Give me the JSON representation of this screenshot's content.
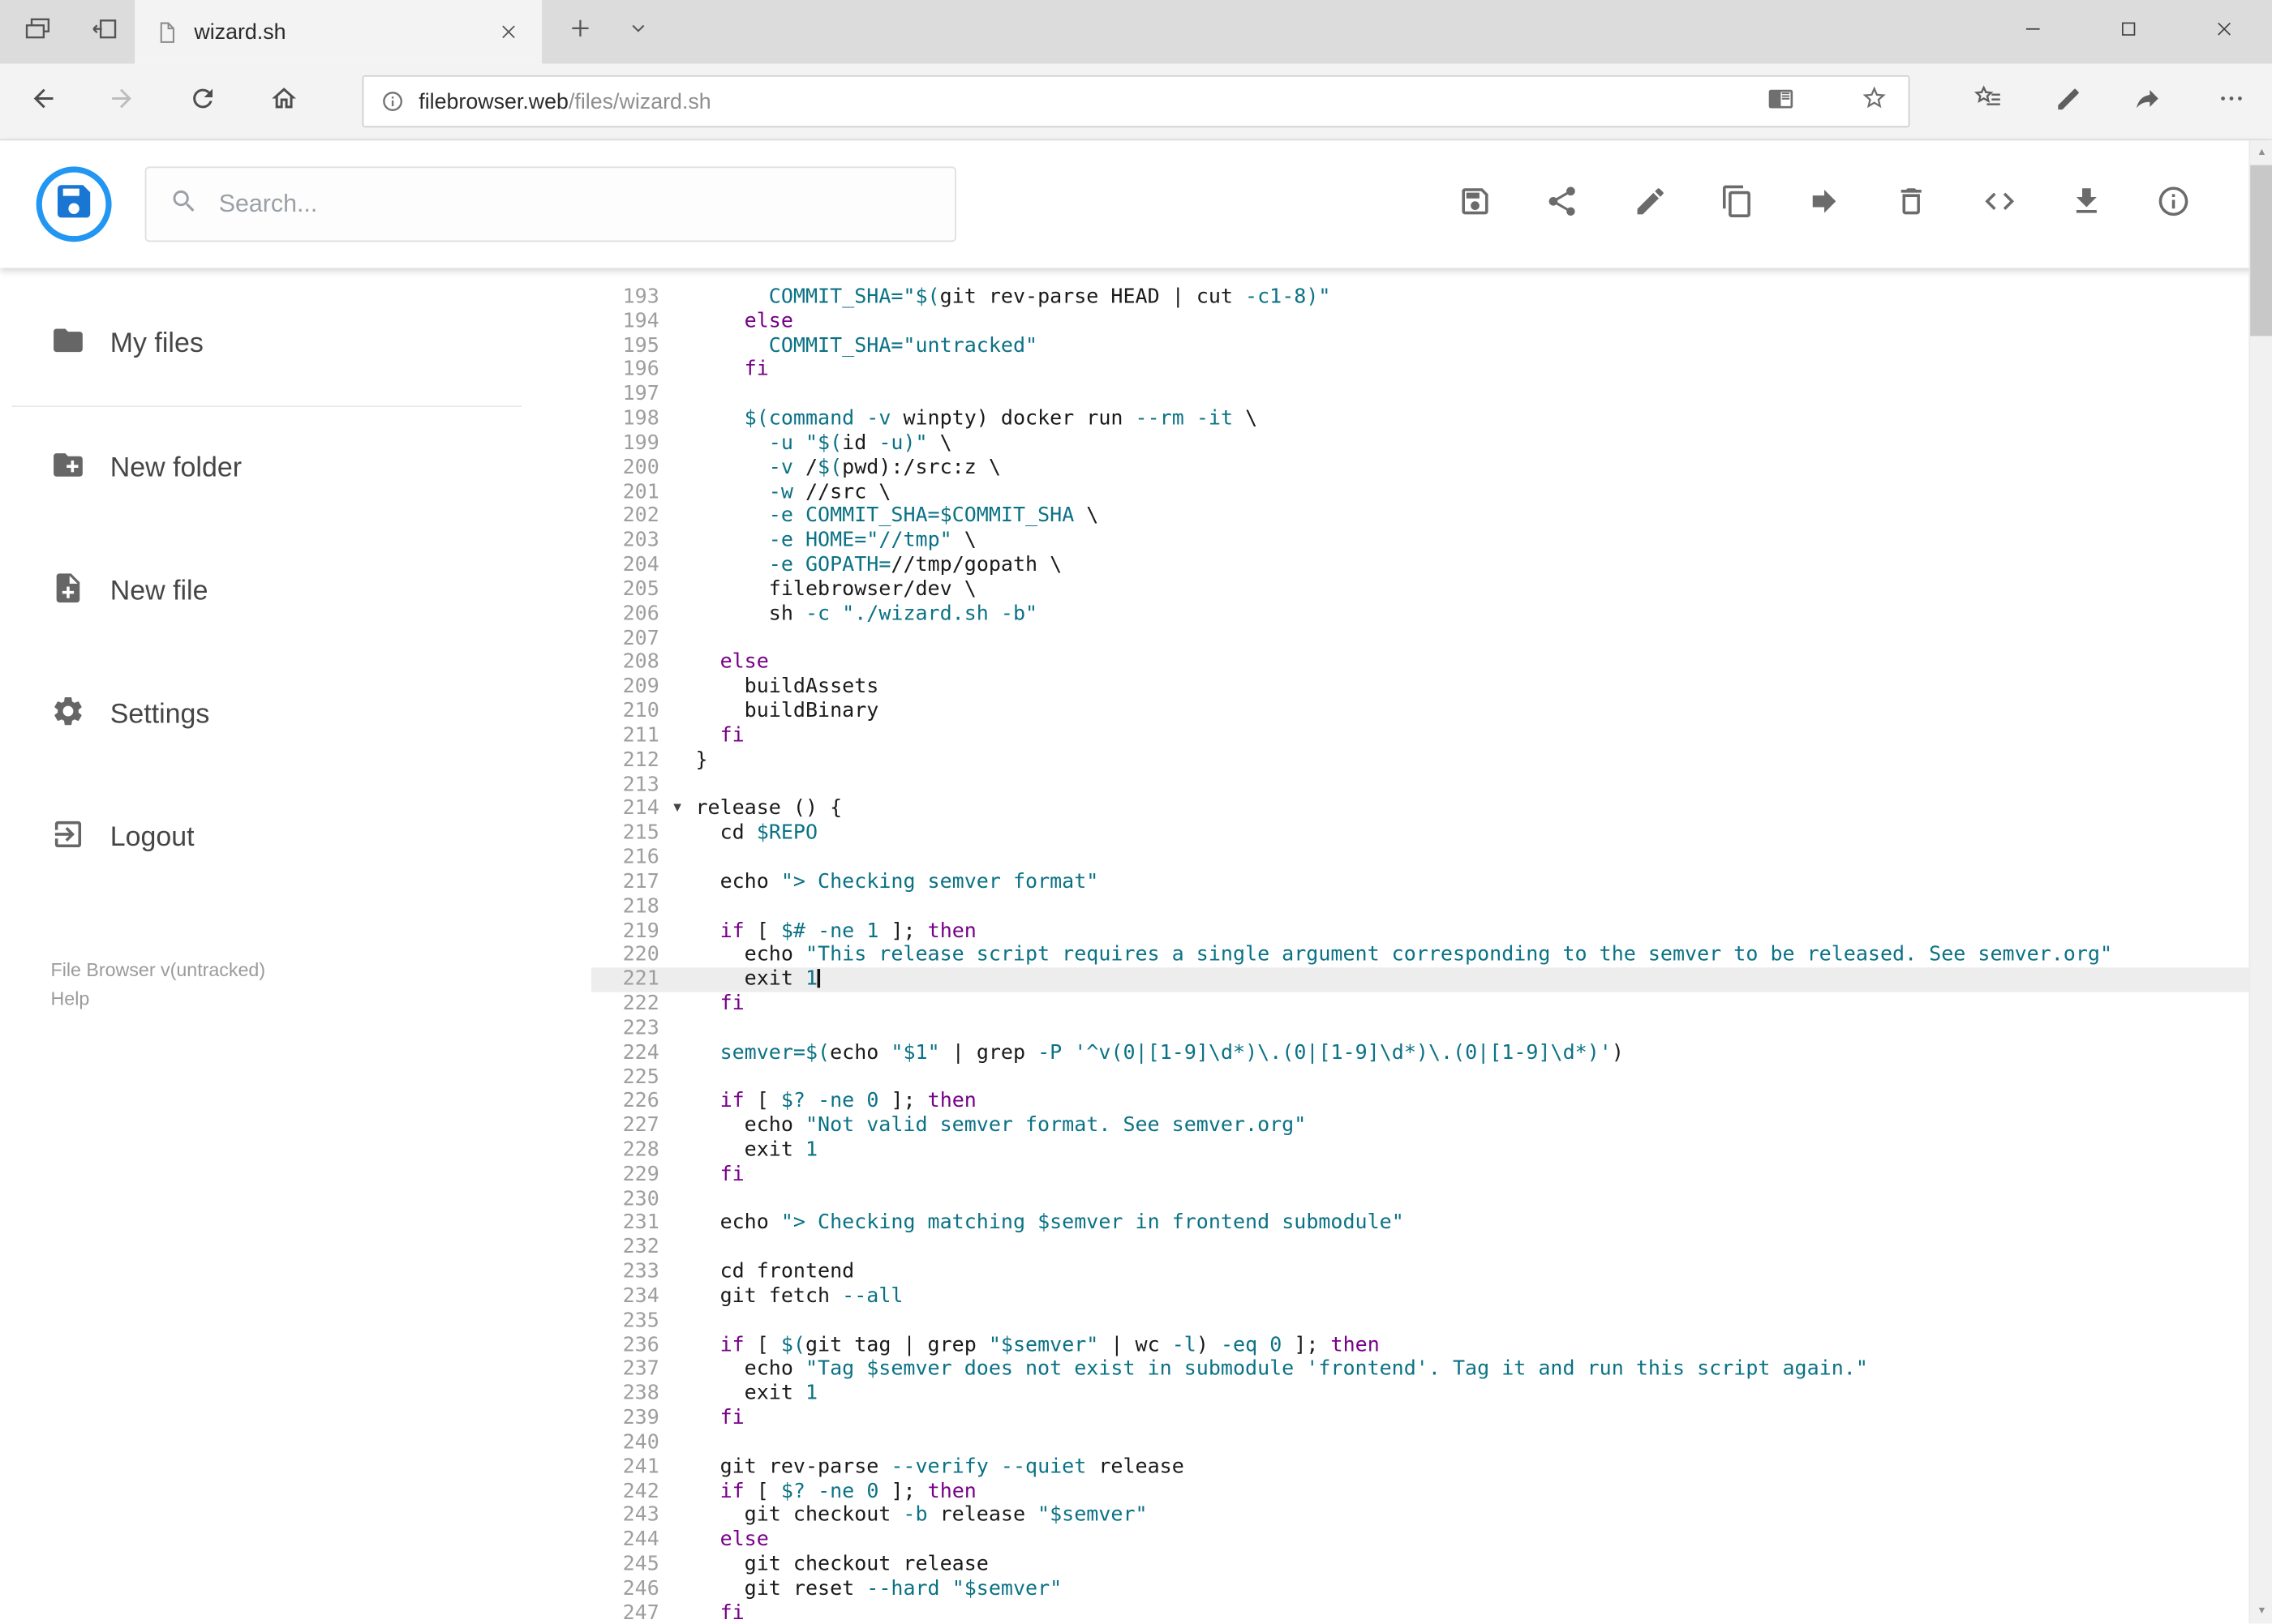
{
  "window": {
    "tab_title": "wizard.sh",
    "url_host": "filebrowser.web",
    "url_path": "/files/wizard.sh"
  },
  "app": {
    "search_placeholder": "Search...",
    "accent_color": "#2196f3",
    "toolbar_icon_color": "#6b6b6b",
    "toolbar_icons": [
      "save-icon",
      "share-icon",
      "edit-icon",
      "copy-icon",
      "move-icon",
      "delete-icon",
      "code-icon",
      "download-icon",
      "info-icon"
    ],
    "sidebar": {
      "items": [
        {
          "icon": "folder-icon",
          "label": "My files"
        },
        {
          "icon": "new-folder-icon",
          "label": "New folder"
        },
        {
          "icon": "new-file-icon",
          "label": "New file"
        },
        {
          "icon": "settings-icon",
          "label": "Settings"
        },
        {
          "icon": "logout-icon",
          "label": "Logout"
        }
      ],
      "footer": [
        "File Browser v(untracked)",
        "Help"
      ]
    }
  },
  "editor": {
    "active_line": 221,
    "cursor_line": 221,
    "fold_marker_line": 214,
    "colors": {
      "keyword": "#770088",
      "accent": "#0b7285",
      "plain": "#1a1a1a",
      "line_number": "#9e9e9e",
      "active_line_bg": "#ededed"
    },
    "lines": [
      {
        "n": 193,
        "t": [
          [
            "p",
            "      "
          ],
          [
            "c",
            "COMMIT_SHA="
          ],
          [
            "c",
            "\"$("
          ],
          [
            "p",
            "git rev-parse HEAD | cut "
          ],
          [
            "c",
            "-c1-8"
          ],
          [
            "c",
            ")\""
          ]
        ]
      },
      {
        "n": 194,
        "t": [
          [
            "p",
            "    "
          ],
          [
            "k",
            "else"
          ]
        ]
      },
      {
        "n": 195,
        "t": [
          [
            "p",
            "      "
          ],
          [
            "c",
            "COMMIT_SHA="
          ],
          [
            "c",
            "\"untracked\""
          ]
        ]
      },
      {
        "n": 196,
        "t": [
          [
            "p",
            "    "
          ],
          [
            "k",
            "fi"
          ]
        ]
      },
      {
        "n": 197,
        "t": []
      },
      {
        "n": 198,
        "t": [
          [
            "p",
            "    "
          ],
          [
            "c",
            "$(command"
          ],
          [
            "p",
            " "
          ],
          [
            "c",
            "-v"
          ],
          [
            "p",
            " winpty) docker run "
          ],
          [
            "c",
            "--rm"
          ],
          [
            "p",
            " "
          ],
          [
            "c",
            "-it"
          ],
          [
            "p",
            " \\"
          ]
        ]
      },
      {
        "n": 199,
        "t": [
          [
            "p",
            "      "
          ],
          [
            "c",
            "-u"
          ],
          [
            "p",
            " "
          ],
          [
            "c",
            "\"$("
          ],
          [
            "p",
            "id "
          ],
          [
            "c",
            "-u"
          ],
          [
            "c",
            ")\""
          ],
          [
            "p",
            " \\"
          ]
        ]
      },
      {
        "n": 200,
        "t": [
          [
            "p",
            "      "
          ],
          [
            "c",
            "-v"
          ],
          [
            "p",
            " /"
          ],
          [
            "c",
            "$("
          ],
          [
            "p",
            "pwd):/src:z \\"
          ]
        ]
      },
      {
        "n": 201,
        "t": [
          [
            "p",
            "      "
          ],
          [
            "c",
            "-w"
          ],
          [
            "p",
            " //src \\"
          ]
        ]
      },
      {
        "n": 202,
        "t": [
          [
            "p",
            "      "
          ],
          [
            "c",
            "-e"
          ],
          [
            "p",
            " "
          ],
          [
            "c",
            "COMMIT_SHA="
          ],
          [
            "c",
            "$COMMIT_SHA"
          ],
          [
            "p",
            " \\"
          ]
        ]
      },
      {
        "n": 203,
        "t": [
          [
            "p",
            "      "
          ],
          [
            "c",
            "-e"
          ],
          [
            "p",
            " "
          ],
          [
            "c",
            "HOME="
          ],
          [
            "c",
            "\"//tmp\""
          ],
          [
            "p",
            " \\"
          ]
        ]
      },
      {
        "n": 204,
        "t": [
          [
            "p",
            "      "
          ],
          [
            "c",
            "-e"
          ],
          [
            "p",
            " "
          ],
          [
            "c",
            "GOPATH="
          ],
          [
            "p",
            "//tmp/gopath \\"
          ]
        ]
      },
      {
        "n": 205,
        "t": [
          [
            "p",
            "      filebrowser/dev \\"
          ]
        ]
      },
      {
        "n": 206,
        "t": [
          [
            "p",
            "      sh "
          ],
          [
            "c",
            "-c"
          ],
          [
            "p",
            " "
          ],
          [
            "c",
            "\"./wizard.sh -b\""
          ]
        ]
      },
      {
        "n": 207,
        "t": []
      },
      {
        "n": 208,
        "t": [
          [
            "p",
            "  "
          ],
          [
            "k",
            "else"
          ]
        ]
      },
      {
        "n": 209,
        "t": [
          [
            "p",
            "    buildAssets"
          ]
        ]
      },
      {
        "n": 210,
        "t": [
          [
            "p",
            "    buildBinary"
          ]
        ]
      },
      {
        "n": 211,
        "t": [
          [
            "p",
            "  "
          ],
          [
            "k",
            "fi"
          ]
        ]
      },
      {
        "n": 212,
        "t": [
          [
            "p",
            "}"
          ]
        ]
      },
      {
        "n": 213,
        "t": []
      },
      {
        "n": 214,
        "t": [
          [
            "p",
            "release () {"
          ]
        ]
      },
      {
        "n": 215,
        "t": [
          [
            "p",
            "  cd "
          ],
          [
            "c",
            "$REPO"
          ]
        ]
      },
      {
        "n": 216,
        "t": []
      },
      {
        "n": 217,
        "t": [
          [
            "p",
            "  echo "
          ],
          [
            "c",
            "\"> Checking semver format\""
          ]
        ]
      },
      {
        "n": 218,
        "t": []
      },
      {
        "n": 219,
        "t": [
          [
            "p",
            "  "
          ],
          [
            "k",
            "if"
          ],
          [
            "p",
            " [ "
          ],
          [
            "c",
            "$#"
          ],
          [
            "p",
            " "
          ],
          [
            "c",
            "-ne"
          ],
          [
            "p",
            " "
          ],
          [
            "c",
            "1"
          ],
          [
            "p",
            " ]; "
          ],
          [
            "k",
            "then"
          ]
        ]
      },
      {
        "n": 220,
        "t": [
          [
            "p",
            "    echo "
          ],
          [
            "c",
            "\"This release script requires a single argument corresponding to the semver to be released. See semver.org\""
          ]
        ]
      },
      {
        "n": 221,
        "t": [
          [
            "p",
            "    exit "
          ],
          [
            "c",
            "1"
          ]
        ]
      },
      {
        "n": 222,
        "t": [
          [
            "p",
            "  "
          ],
          [
            "k",
            "fi"
          ]
        ]
      },
      {
        "n": 223,
        "t": []
      },
      {
        "n": 224,
        "t": [
          [
            "p",
            "  "
          ],
          [
            "c",
            "semver="
          ],
          [
            "c",
            "$("
          ],
          [
            "p",
            "echo "
          ],
          [
            "c",
            "\"$1\""
          ],
          [
            "p",
            " | grep "
          ],
          [
            "c",
            "-P"
          ],
          [
            "p",
            " "
          ],
          [
            "c",
            "'^v(0|[1-9]\\d*)\\.(0|[1-9]\\d*)\\.(0|[1-9]\\d*)'"
          ],
          [
            "p",
            ")"
          ]
        ]
      },
      {
        "n": 225,
        "t": []
      },
      {
        "n": 226,
        "t": [
          [
            "p",
            "  "
          ],
          [
            "k",
            "if"
          ],
          [
            "p",
            " [ "
          ],
          [
            "c",
            "$?"
          ],
          [
            "p",
            " "
          ],
          [
            "c",
            "-ne"
          ],
          [
            "p",
            " "
          ],
          [
            "c",
            "0"
          ],
          [
            "p",
            " ]; "
          ],
          [
            "k",
            "then"
          ]
        ]
      },
      {
        "n": 227,
        "t": [
          [
            "p",
            "    echo "
          ],
          [
            "c",
            "\"Not valid semver format. See semver.org\""
          ]
        ]
      },
      {
        "n": 228,
        "t": [
          [
            "p",
            "    exit "
          ],
          [
            "c",
            "1"
          ]
        ]
      },
      {
        "n": 229,
        "t": [
          [
            "p",
            "  "
          ],
          [
            "k",
            "fi"
          ]
        ]
      },
      {
        "n": 230,
        "t": []
      },
      {
        "n": 231,
        "t": [
          [
            "p",
            "  echo "
          ],
          [
            "c",
            "\"> Checking matching $semver in frontend submodule\""
          ]
        ]
      },
      {
        "n": 232,
        "t": []
      },
      {
        "n": 233,
        "t": [
          [
            "p",
            "  cd frontend"
          ]
        ]
      },
      {
        "n": 234,
        "t": [
          [
            "p",
            "  git fetch "
          ],
          [
            "c",
            "--all"
          ]
        ]
      },
      {
        "n": 235,
        "t": []
      },
      {
        "n": 236,
        "t": [
          [
            "p",
            "  "
          ],
          [
            "k",
            "if"
          ],
          [
            "p",
            " [ "
          ],
          [
            "c",
            "$("
          ],
          [
            "p",
            "git tag | grep "
          ],
          [
            "c",
            "\"$semver\""
          ],
          [
            "p",
            " | wc "
          ],
          [
            "c",
            "-l"
          ],
          [
            "p",
            ") "
          ],
          [
            "c",
            "-eq"
          ],
          [
            "p",
            " "
          ],
          [
            "c",
            "0"
          ],
          [
            "p",
            " ]; "
          ],
          [
            "k",
            "then"
          ]
        ]
      },
      {
        "n": 237,
        "t": [
          [
            "p",
            "    echo "
          ],
          [
            "c",
            "\"Tag $semver does not exist in submodule 'frontend'. Tag it and run this script again.\""
          ]
        ]
      },
      {
        "n": 238,
        "t": [
          [
            "p",
            "    exit "
          ],
          [
            "c",
            "1"
          ]
        ]
      },
      {
        "n": 239,
        "t": [
          [
            "p",
            "  "
          ],
          [
            "k",
            "fi"
          ]
        ]
      },
      {
        "n": 240,
        "t": []
      },
      {
        "n": 241,
        "t": [
          [
            "p",
            "  git rev-parse "
          ],
          [
            "c",
            "--verify"
          ],
          [
            "p",
            " "
          ],
          [
            "c",
            "--quiet"
          ],
          [
            "p",
            " release"
          ]
        ]
      },
      {
        "n": 242,
        "t": [
          [
            "p",
            "  "
          ],
          [
            "k",
            "if"
          ],
          [
            "p",
            " [ "
          ],
          [
            "c",
            "$?"
          ],
          [
            "p",
            " "
          ],
          [
            "c",
            "-ne"
          ],
          [
            "p",
            " "
          ],
          [
            "c",
            "0"
          ],
          [
            "p",
            " ]; "
          ],
          [
            "k",
            "then"
          ]
        ]
      },
      {
        "n": 243,
        "t": [
          [
            "p",
            "    git checkout "
          ],
          [
            "c",
            "-b"
          ],
          [
            "p",
            " release "
          ],
          [
            "c",
            "\"$semver\""
          ]
        ]
      },
      {
        "n": 244,
        "t": [
          [
            "p",
            "  "
          ],
          [
            "k",
            "else"
          ]
        ]
      },
      {
        "n": 245,
        "t": [
          [
            "p",
            "    git checkout release"
          ]
        ]
      },
      {
        "n": 246,
        "t": [
          [
            "p",
            "    git reset "
          ],
          [
            "c",
            "--hard"
          ],
          [
            "p",
            " "
          ],
          [
            "c",
            "\"$semver\""
          ]
        ]
      },
      {
        "n": 247,
        "t": [
          [
            "p",
            "  "
          ],
          [
            "k",
            "fi"
          ]
        ]
      }
    ]
  }
}
